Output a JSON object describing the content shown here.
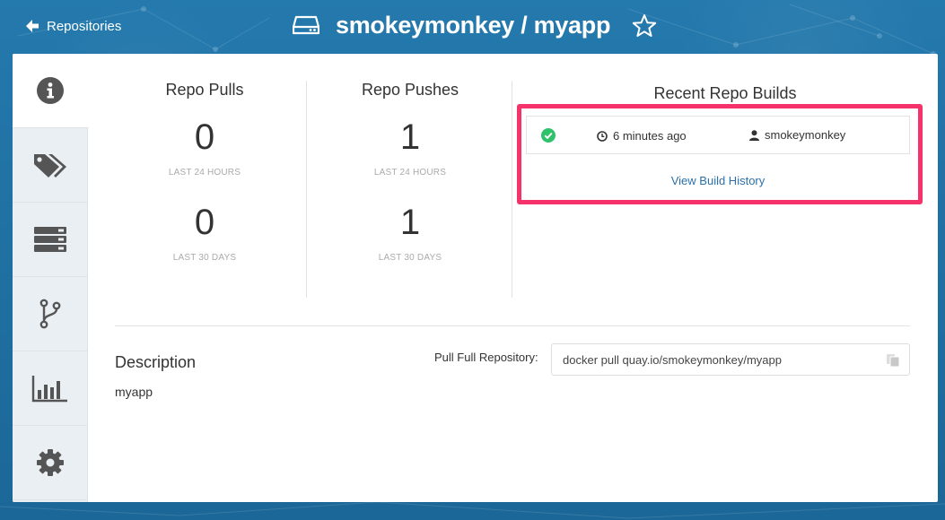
{
  "header": {
    "back_label": "Repositories",
    "repo_title": "smokeymonkey / myapp"
  },
  "side_tabs": [
    {
      "icon": "info-icon",
      "active": true
    },
    {
      "icon": "tags-icon",
      "active": false
    },
    {
      "icon": "builds-icon",
      "active": false
    },
    {
      "icon": "git-branch-icon",
      "active": false
    },
    {
      "icon": "bar-chart-icon",
      "active": false
    },
    {
      "icon": "gear-icon",
      "active": false
    }
  ],
  "stats": {
    "pulls": {
      "heading": "Repo Pulls",
      "day_value": "0",
      "day_label": "LAST 24 HOURS",
      "month_value": "0",
      "month_label": "LAST 30 DAYS"
    },
    "pushes": {
      "heading": "Repo Pushes",
      "day_value": "1",
      "day_label": "LAST 24 HOURS",
      "month_value": "1",
      "month_label": "LAST 30 DAYS"
    }
  },
  "builds": {
    "heading": "Recent Repo Builds",
    "items": [
      {
        "status": "success",
        "time": "6 minutes ago",
        "user": "smokeymonkey"
      }
    ],
    "history_link": "View Build History"
  },
  "description": {
    "heading": "Description",
    "text": "myapp"
  },
  "pull": {
    "label": "Pull Full Repository:",
    "command": "docker pull quay.io/smokeymonkey/myapp"
  },
  "colors": {
    "header_bg": "#2479ad",
    "highlight": "#f5336a",
    "success": "#2fc26b",
    "link": "#2b70a8"
  }
}
